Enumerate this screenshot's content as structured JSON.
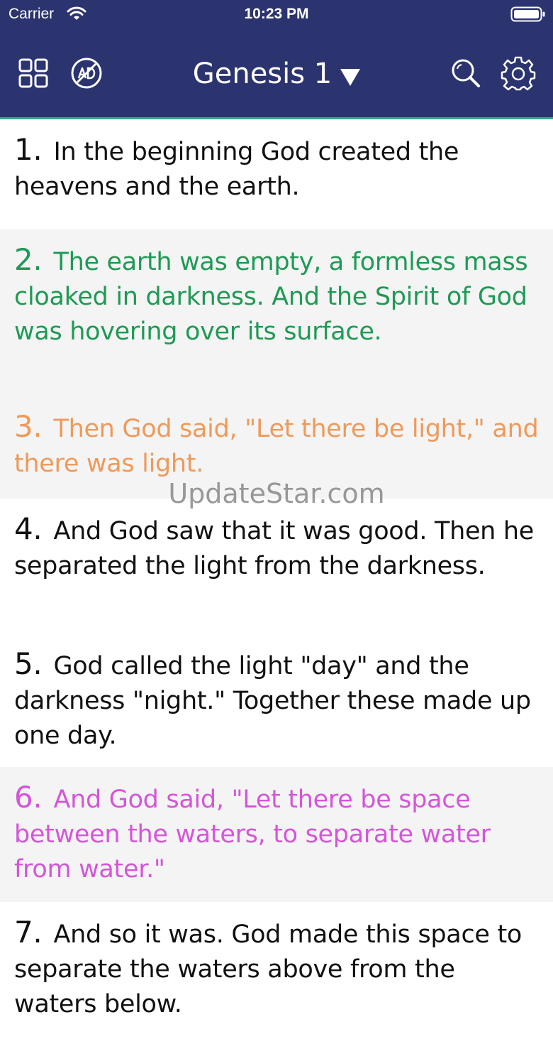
{
  "status_bar": {
    "carrier": "Carrier",
    "time": "10:23 PM",
    "wifi_icon": "wifi-icon",
    "battery_icon": "battery-icon"
  },
  "nav": {
    "title": "Genesis 1",
    "icons": [
      "grid-icon",
      "no-ads-icon",
      "search-icon",
      "gear-icon"
    ],
    "background": "#2b346f",
    "accent_line": "#3fa38f"
  },
  "verses": [
    {
      "number": "1.",
      "text": "In the beginning God created the heavens and the earth.",
      "color": "#111111",
      "bg": "#ffffff",
      "height": 155
    },
    {
      "number": "2.",
      "text": "The earth was empty, a formless mass cloaked in darkness. And the Spirit of God was hovering over its surface.",
      "color": "#1e9a55",
      "bg": "#f4f4f4",
      "height": 235
    },
    {
      "number": "3.",
      "text": "Then God said, \"Let there be light,\" and there was light.",
      "color": "#ee9a5a",
      "bg": "#f4f4f4",
      "height": 144
    },
    {
      "number": "4.",
      "text": "And God saw that it was good. Then he separated the light from the darkness.",
      "color": "#111111",
      "bg": "#ffffff",
      "height": 190
    },
    {
      "number": "5.",
      "text": "God called the light \"day\" and the darkness \"night.\" Together these made up one day.",
      "color": "#111111",
      "bg": "#ffffff",
      "height": 188
    },
    {
      "number": "6.",
      "text": "And God said, \"Let there be space between the waters, to separate water from water.\"",
      "color": "#d456d8",
      "bg": "#f4f4f4",
      "height": 190
    },
    {
      "number": "7.",
      "text": "And so it was. God made this space to separate the waters above from the waters below.",
      "color": "#111111",
      "bg": "#ffffff",
      "height": 200
    }
  ],
  "watermark": "UpdateStar.com"
}
